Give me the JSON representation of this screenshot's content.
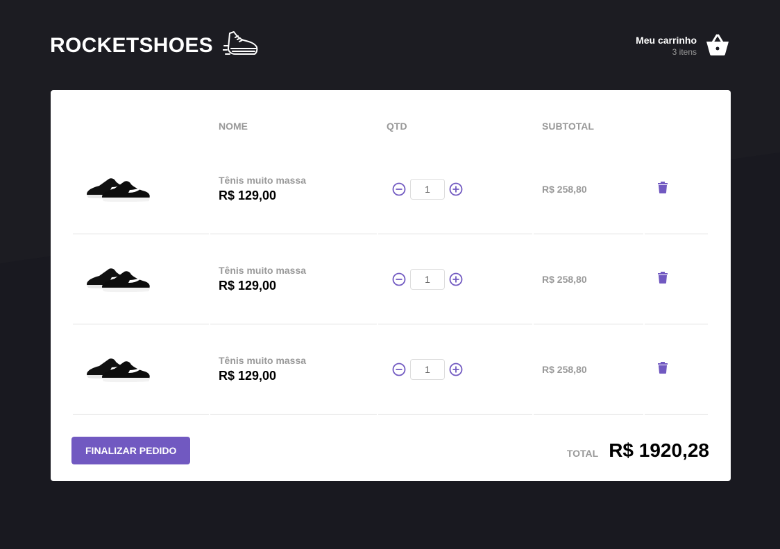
{
  "header": {
    "logo_text": "ROCKETSHOES",
    "cart_title": "Meu carrinho",
    "cart_count": "3 itens"
  },
  "table": {
    "columns": [
      "",
      "NOME",
      "QTD",
      "SUBTOTAL",
      ""
    ],
    "rows": [
      {
        "title": "Tênis muito massa",
        "price": "R$ 129,00",
        "qty": "1",
        "subtotal": "R$ 258,80"
      },
      {
        "title": "Tênis muito massa",
        "price": "R$ 129,00",
        "qty": "1",
        "subtotal": "R$ 258,80"
      },
      {
        "title": "Tênis muito massa",
        "price": "R$ 129,00",
        "qty": "1",
        "subtotal": "R$ 258,80"
      }
    ]
  },
  "footer": {
    "finish_label": "FINALIZAR PEDIDO",
    "total_label": "TOTAL",
    "total_value": "R$ 1920,28"
  },
  "colors": {
    "accent": "#7159c1",
    "background": "#191920",
    "panel": "#ffffff"
  },
  "icons": {
    "logo": "sneaker-icon",
    "cart": "shopping-basket-icon",
    "decrement": "minus-circle-icon",
    "increment": "plus-circle-icon",
    "delete": "trash-icon"
  }
}
